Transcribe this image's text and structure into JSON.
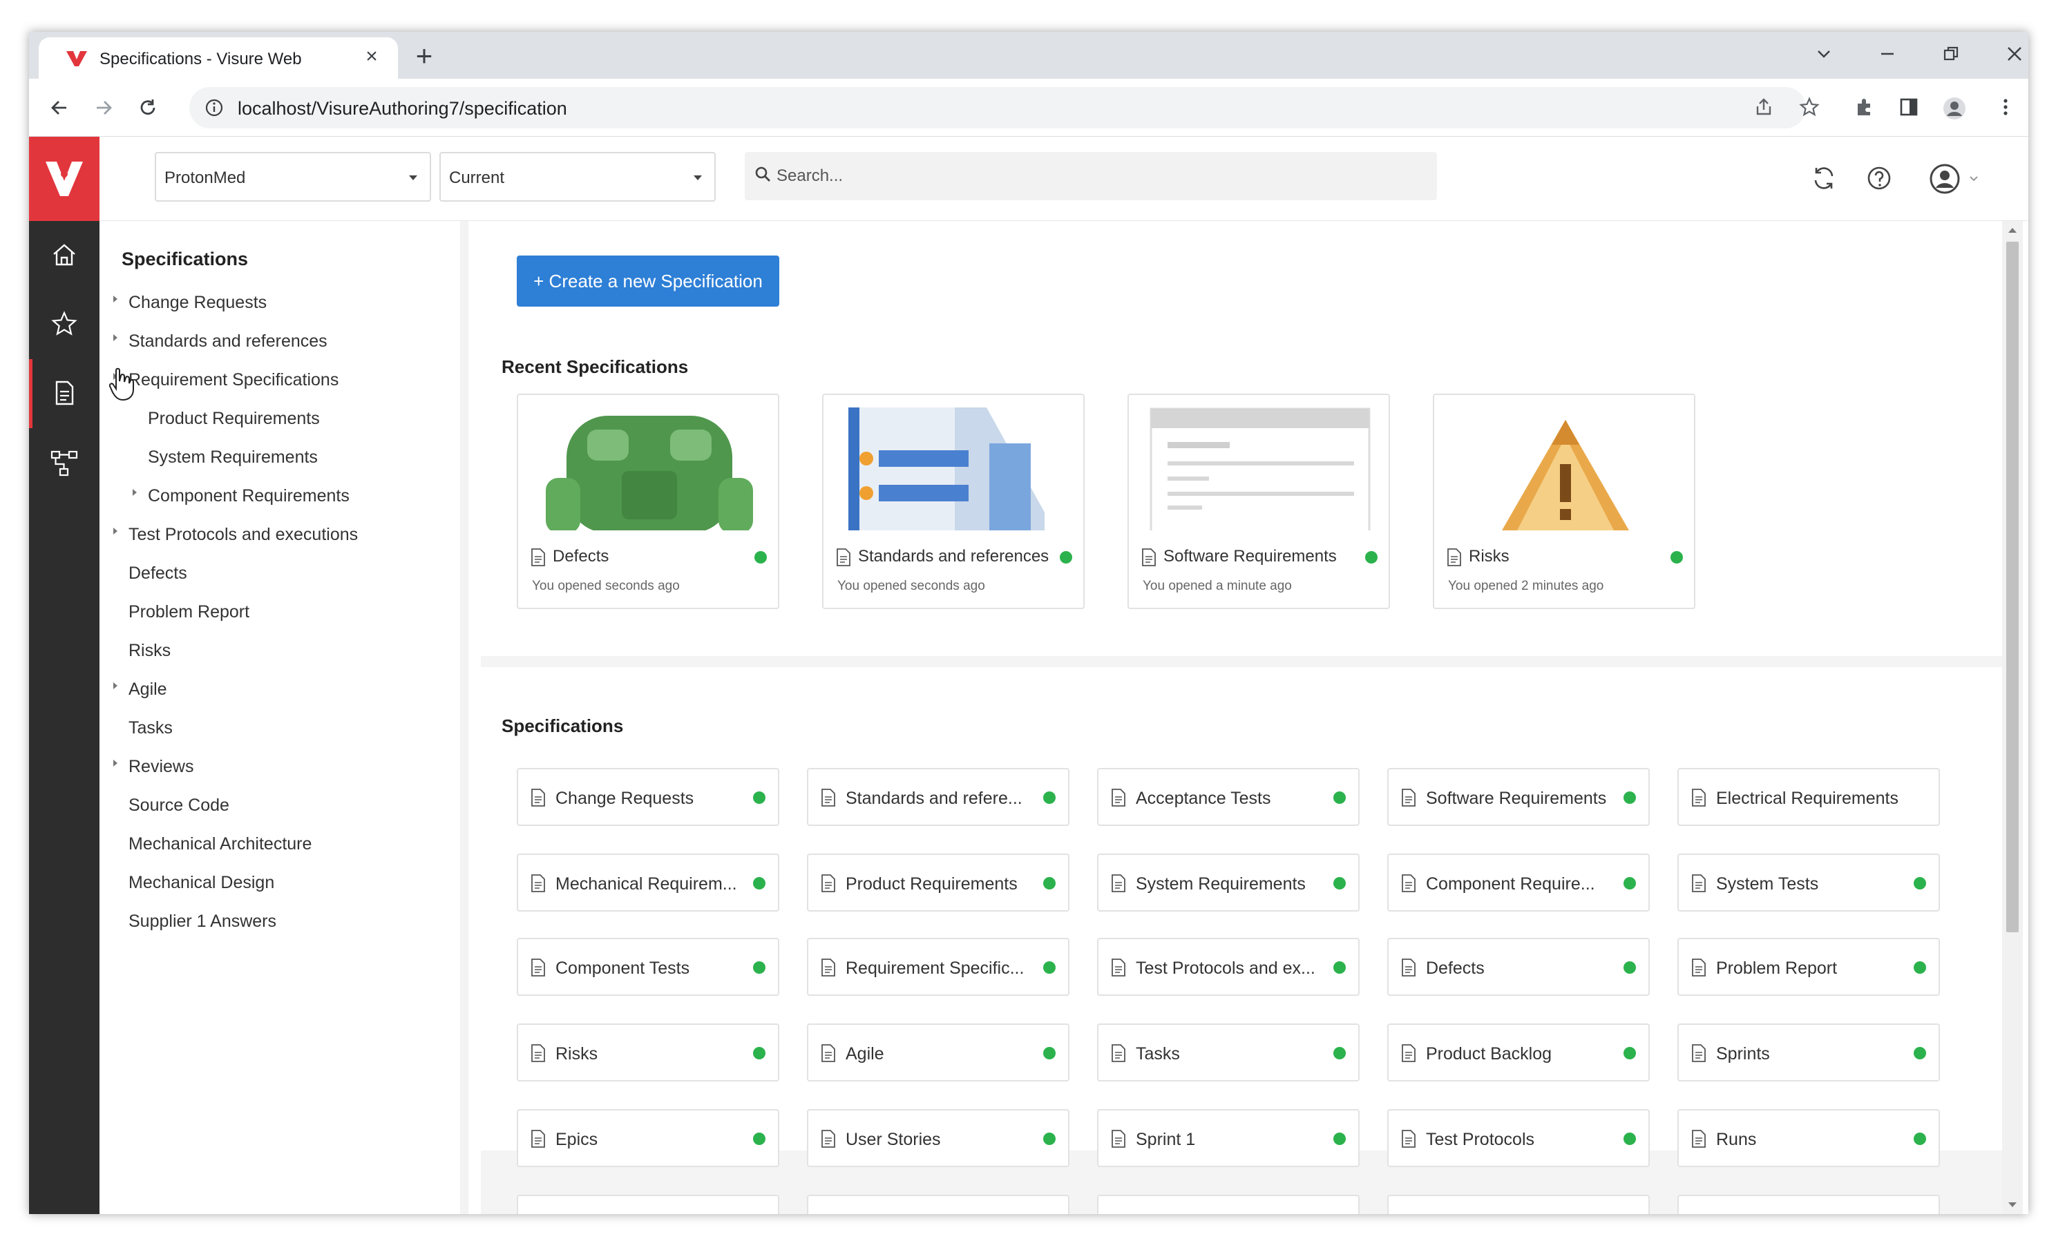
{
  "browser": {
    "tab_title": "Specifications - Visure Web",
    "url": "localhost/VisureAuthoring7/specification"
  },
  "header": {
    "project": "ProtonMed",
    "baseline": "Current",
    "search_placeholder": "Search..."
  },
  "tree": {
    "title": "Specifications",
    "items": [
      {
        "label": "Change Requests",
        "expandable": true
      },
      {
        "label": "Standards and references",
        "expandable": true
      },
      {
        "label": "Requirement Specifications",
        "expandable": true
      },
      {
        "label": "Product Requirements",
        "expandable": false
      },
      {
        "label": "System Requirements",
        "expandable": false
      },
      {
        "label": "Component Requirements",
        "expandable": true
      },
      {
        "label": "Test Protocols and executions",
        "expandable": true
      },
      {
        "label": "Defects",
        "expandable": false
      },
      {
        "label": "Problem Report",
        "expandable": false
      },
      {
        "label": "Risks",
        "expandable": false
      },
      {
        "label": "Agile",
        "expandable": true
      },
      {
        "label": "Tasks",
        "expandable": false
      },
      {
        "label": "Reviews",
        "expandable": true
      },
      {
        "label": "Source Code",
        "expandable": false
      },
      {
        "label": "Mechanical Architecture",
        "expandable": false
      },
      {
        "label": "Mechanical Design",
        "expandable": false
      },
      {
        "label": "Supplier 1 Answers",
        "expandable": false
      }
    ]
  },
  "main": {
    "create_button": "+ Create a new Specification",
    "recent_title": "Recent Specifications",
    "recent": [
      {
        "name": "Defects",
        "opened": "You opened seconds ago"
      },
      {
        "name": "Standards and references",
        "opened": "You opened seconds ago"
      },
      {
        "name": "Software Requirements",
        "opened": "You opened a minute ago"
      },
      {
        "name": "Risks",
        "opened": "You opened 2 minutes ago"
      }
    ],
    "specs_title": "Specifications",
    "specs": [
      {
        "name": "Change Requests",
        "status": true
      },
      {
        "name": "Standards and refere...",
        "status": true
      },
      {
        "name": "Acceptance Tests",
        "status": true
      },
      {
        "name": "Software Requirements",
        "status": true
      },
      {
        "name": "Electrical Requirements",
        "status": false
      },
      {
        "name": "Mechanical Requirem...",
        "status": true
      },
      {
        "name": "Product Requirements",
        "status": true
      },
      {
        "name": "System Requirements",
        "status": true
      },
      {
        "name": "Component Require...",
        "status": true
      },
      {
        "name": "System Tests",
        "status": true
      },
      {
        "name": "Component Tests",
        "status": true
      },
      {
        "name": "Requirement Specific...",
        "status": true
      },
      {
        "name": "Test Protocols and ex...",
        "status": true
      },
      {
        "name": "Defects",
        "status": true
      },
      {
        "name": "Problem Report",
        "status": true
      },
      {
        "name": "Risks",
        "status": true
      },
      {
        "name": "Agile",
        "status": true
      },
      {
        "name": "Tasks",
        "status": true
      },
      {
        "name": "Product Backlog",
        "status": true
      },
      {
        "name": "Sprints",
        "status": true
      },
      {
        "name": "Epics",
        "status": true
      },
      {
        "name": "User Stories",
        "status": true
      },
      {
        "name": "Sprint 1",
        "status": true
      },
      {
        "name": "Test Protocols",
        "status": true
      },
      {
        "name": "Runs",
        "status": true
      }
    ]
  },
  "colors": {
    "brand": "#e2363d",
    "primary_button": "#2e7fd6",
    "status_ok": "#2bb24c",
    "rail": "#2d2d2d"
  }
}
